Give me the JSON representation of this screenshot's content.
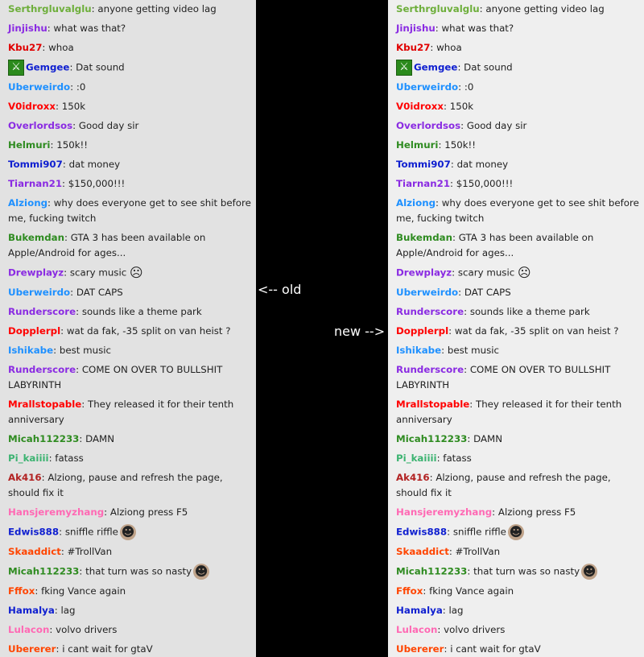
{
  "arrows": {
    "old": "<-- old",
    "new": "new -->"
  },
  "emotes": {
    "sword": "⚔",
    "sad": "☹",
    "face": "☻"
  },
  "old_chat": [
    {
      "user": "Serthrgluvalglu",
      "color": "#6dae3a",
      "text": ": anyone getting video lag"
    },
    {
      "user": "Jinjishu",
      "color": "#8a2be2",
      "text": ": what was that?"
    },
    {
      "user": "Kbu27",
      "color": "#e00000",
      "text": ": whoa"
    },
    {
      "user": "Gemgee",
      "color": "#1020d0",
      "text": ": Dat sound",
      "badge": "sword"
    },
    {
      "user": "Uberweirdo",
      "color": "#1e90ff",
      "text": ": :0"
    },
    {
      "user": "V0idroxx",
      "color": "#ff0000",
      "text": ": 150k"
    },
    {
      "user": "Overlordsos",
      "color": "#8a2be2",
      "text": ": Good day sir"
    },
    {
      "user": "Helmuri",
      "color": "#2e8b20",
      "text": ": 150k!!"
    },
    {
      "user": "Tommi907",
      "color": "#1020d0",
      "text": ": dat money"
    },
    {
      "user": "Tiarnan21",
      "color": "#8a2be2",
      "text": ": $150,000!!!"
    },
    {
      "user": "Alziong",
      "color": "#1e90ff",
      "text": ": why does everyone get to see shit before me, fucking twitch"
    },
    {
      "user": "Bukemdan",
      "color": "#2e8b20",
      "text": ": GTA 3 has been available on Apple/Android for ages..."
    },
    {
      "user": "Drewplayz",
      "color": "#8a2be2",
      "text": ": scary music",
      "emote": "sad"
    },
    {
      "user": "Uberweirdo",
      "color": "#1e90ff",
      "text": ": DAT CAPS"
    },
    {
      "user": "Runderscore",
      "color": "#8a2be2",
      "text": ": sounds like a theme park"
    },
    {
      "user": "Dopplerpl",
      "color": "#ff0000",
      "text": ": wat da fak, -35 split on van heist ?"
    },
    {
      "user": "Ishikabe",
      "color": "#1e90ff",
      "text": ": best music"
    },
    {
      "user": "Runderscore",
      "color": "#8a2be2",
      "text": ": COME ON OVER TO BULLSHIT LABYRINTH"
    },
    {
      "user": "Mrallstopable",
      "color": "#ff0000",
      "text": ": They released it for their tenth anniversary"
    },
    {
      "user": "Micah112233",
      "color": "#2e8b20",
      "text": ": DAMN"
    },
    {
      "user": "Pi_kaiiii",
      "color": "#3cb371",
      "text": ": fatass"
    },
    {
      "user": "Ak416",
      "color": "#b22222",
      "text": ": Alziong, pause and refresh the page, should fix it"
    },
    {
      "user": "Hansjeremyzhang",
      "color": "#ff69b4",
      "text": ": Alziong press F5"
    },
    {
      "user": "Edwis888",
      "color": "#1020d0",
      "text": ": sniffle riffle",
      "emote": "face"
    },
    {
      "user": "Skaaddict",
      "color": "#ff4500",
      "text": ": #TrollVan"
    },
    {
      "user": "Micah112233",
      "color": "#2e8b20",
      "text": ": that turn was so nasty",
      "emote": "face"
    },
    {
      "user": "Fffox",
      "color": "#ff4500",
      "text": ": fking Vance again"
    },
    {
      "user": "Hamalya",
      "color": "#1020d0",
      "text": ": lag"
    },
    {
      "user": "Lulacon",
      "color": "#ff69b4",
      "text": ": volvo drivers"
    },
    {
      "user": "Ubererer",
      "color": "#ff4500",
      "text": ": i cant wait for gtaV"
    }
  ],
  "new_chat": [
    {
      "user": "Serthrgluvalglu",
      "color": "#6dae3a",
      "text": ": anyone getting video lag"
    },
    {
      "user": "Jinjishu",
      "color": "#8a2be2",
      "text": ": what was that?"
    },
    {
      "user": "Kbu27",
      "color": "#e00000",
      "text": ": whoa"
    },
    {
      "user": "Gemgee",
      "color": "#1020d0",
      "text": ": Dat sound",
      "badge": "sword"
    },
    {
      "user": "Uberweirdo",
      "color": "#1e90ff",
      "text": ": :0"
    },
    {
      "user": "V0idroxx",
      "color": "#ff0000",
      "text": ": 150k"
    },
    {
      "user": "Overlordsos",
      "color": "#8a2be2",
      "text": ": Good day sir"
    },
    {
      "user": "Helmuri",
      "color": "#2e8b20",
      "text": ": 150k!!"
    },
    {
      "user": "Tommi907",
      "color": "#1020d0",
      "text": ": dat money"
    },
    {
      "user": "Tiarnan21",
      "color": "#8a2be2",
      "text": ": $150,000!!!"
    },
    {
      "user": "Alziong",
      "color": "#1e90ff",
      "text": ": why does everyone get to see shit before me, fucking twitch"
    },
    {
      "user": "Bukemdan",
      "color": "#2e8b20",
      "text": ": GTA 3 has been available on Apple/Android for ages..."
    },
    {
      "user": "Drewplayz",
      "color": "#8a2be2",
      "text": ": scary music",
      "emote": "sad"
    },
    {
      "user": "Uberweirdo",
      "color": "#1e90ff",
      "text": ": DAT CAPS"
    },
    {
      "user": "Runderscore",
      "color": "#8a2be2",
      "text": ": sounds like a theme park"
    },
    {
      "user": "Dopplerpl",
      "color": "#ff0000",
      "text": ": wat da fak, -35 split on van heist ?"
    },
    {
      "user": "Ishikabe",
      "color": "#1e90ff",
      "text": ": best music"
    },
    {
      "user": "Runderscore",
      "color": "#8a2be2",
      "text": ": COME ON OVER TO BULLSHIT LABYRINTH"
    },
    {
      "user": "Mrallstopable",
      "color": "#ff0000",
      "text": ": They released it for their tenth anniversary"
    },
    {
      "user": "Micah112233",
      "color": "#2e8b20",
      "text": ": DAMN"
    },
    {
      "user": "Pi_kaiiii",
      "color": "#3cb371",
      "text": ": fatass"
    },
    {
      "user": "Ak416",
      "color": "#b22222",
      "text": ": Alziong, pause and refresh the page, should fix it"
    },
    {
      "user": "Hansjeremyzhang",
      "color": "#ff69b4",
      "text": ": Alziong press F5"
    },
    {
      "user": "Edwis888",
      "color": "#1020d0",
      "text": ": sniffle riffle",
      "emote": "face"
    },
    {
      "user": "Skaaddict",
      "color": "#ff4500",
      "text": ": #TrollVan"
    },
    {
      "user": "Micah112233",
      "color": "#2e8b20",
      "text": ": that turn was so nasty",
      "emote": "face"
    },
    {
      "user": "Fffox",
      "color": "#ff4500",
      "text": ": fking Vance again"
    },
    {
      "user": "Hamalya",
      "color": "#1020d0",
      "text": ": lag"
    },
    {
      "user": "Lulacon",
      "color": "#ff69b4",
      "text": ": volvo drivers"
    },
    {
      "user": "Ubererer",
      "color": "#ff4500",
      "text": ": i cant wait for gtaV"
    }
  ]
}
